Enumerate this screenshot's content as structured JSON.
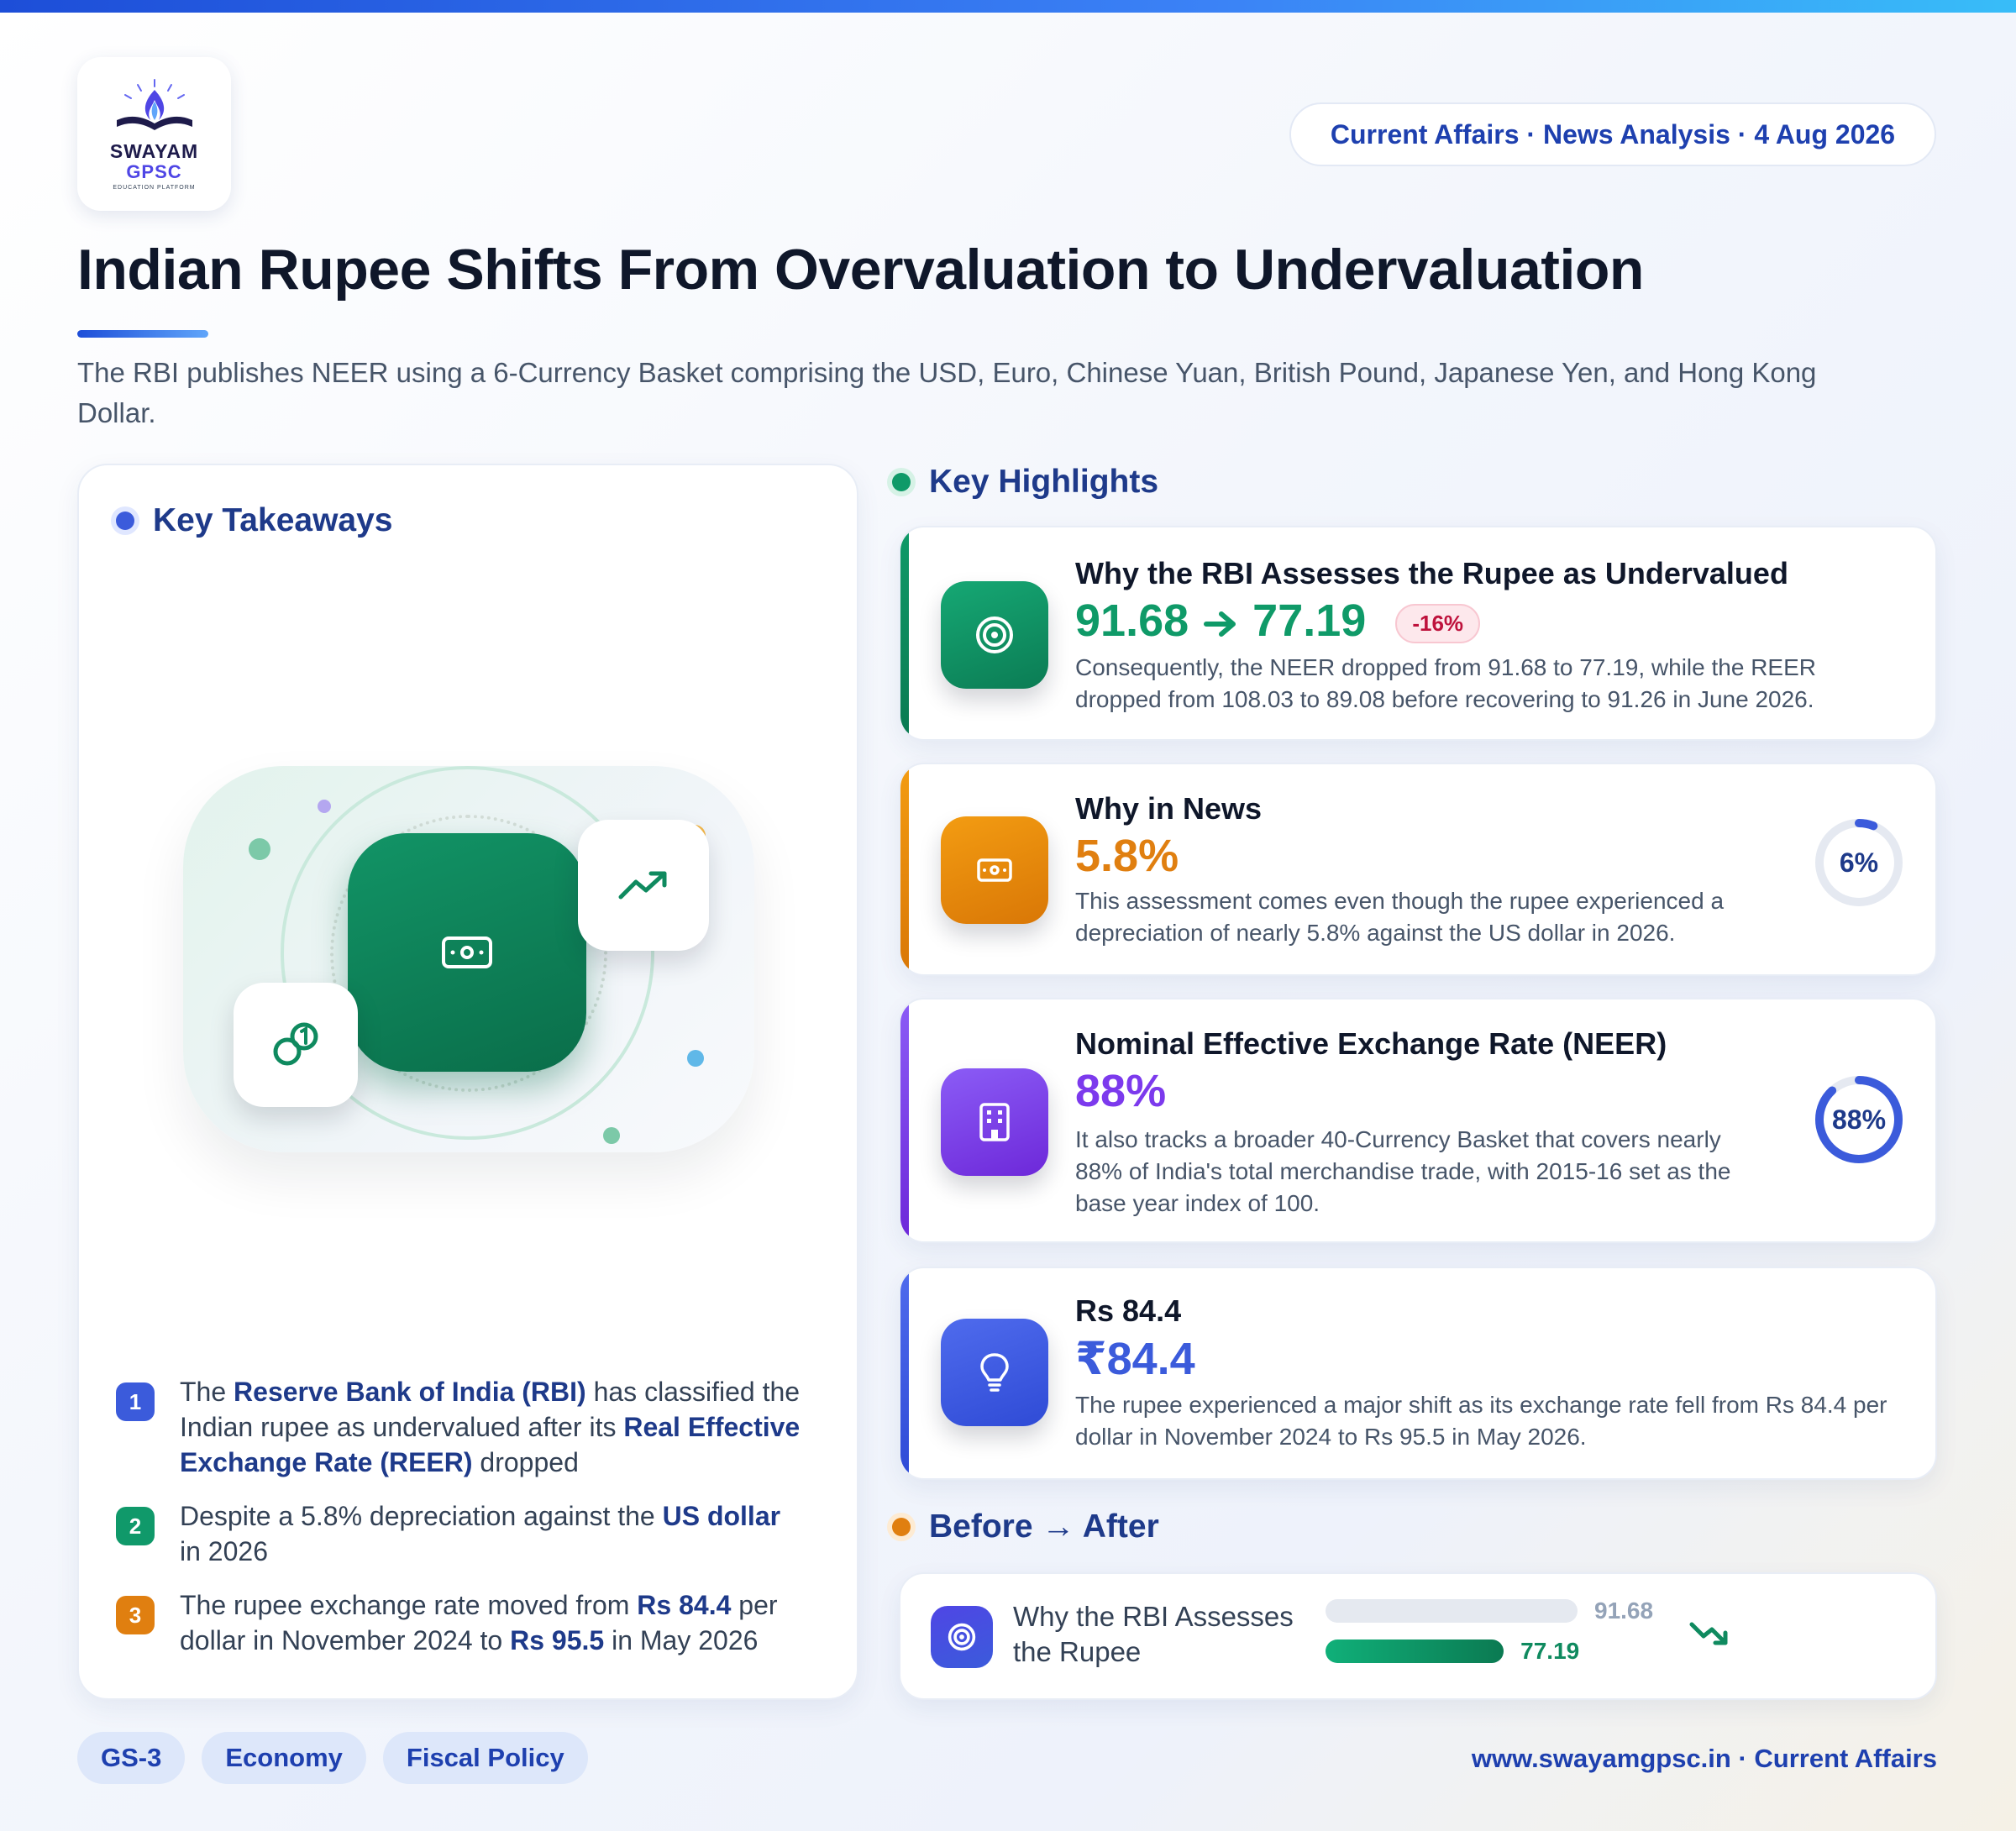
{
  "logo": {
    "line1": "SWAYAM",
    "line2": "GPSC",
    "line3": "EDUCATION PLATFORM"
  },
  "header": {
    "date_pill": "Current Affairs · News Analysis · 4 Aug 2026",
    "title": "Indian Rupee Shifts From Overvaluation to Undervaluation",
    "subtitle": "The RBI publishes NEER using a 6-Currency Basket comprising the USD, Euro, Chinese Yuan, British Pound, Japanese Yen, and Hong Kong Dollar."
  },
  "takeaways": {
    "heading": "Key Takeaways",
    "items": [
      {
        "num": "1",
        "color": "#3b5bdb"
      },
      {
        "num": "2",
        "color": "#10996a"
      },
      {
        "num": "3",
        "color": "#e07f10"
      }
    ],
    "item1": {
      "a": "The ",
      "b": "Reserve Bank of India (RBI)",
      "c": " has classified the Indian rupee as undervalued after its ",
      "d": "Real Effective Exchange Rate (REER)",
      "e": " dropped"
    },
    "item2": {
      "a": "Despite a 5.8% depreciation against the ",
      "b": "US dollar",
      "c": " in 2026"
    },
    "item3": {
      "a": "The rupee exchange rate moved from ",
      "b": "Rs 84.4",
      "c": " per dollar in November 2024 to ",
      "d": "Rs 95.5",
      "e": " in May 2026"
    }
  },
  "highlights": {
    "heading": "Key Highlights",
    "cards": [
      {
        "title": "Why the RBI Assesses the Rupee as Undervalued",
        "from": "91.68",
        "to": "77.19",
        "change": "-16%",
        "desc": "Consequently, the NEER dropped from 91.68 to 77.19, while the REER dropped from 108.03 to 89.08 before recovering to 91.26 in June 2026.",
        "icon": "target-icon",
        "color": "#0f9a68"
      },
      {
        "title": "Why in News",
        "value": "5.8%",
        "gauge_label": "6%",
        "gauge_fraction": 0.06,
        "desc": "This assessment comes even though the rupee experienced a depreciation of nearly 5.8% against the US dollar in 2026.",
        "icon": "banknote-icon",
        "color": "#e07f10"
      },
      {
        "title": "Nominal Effective Exchange Rate (NEER)",
        "value": "88%",
        "gauge_label": "88%",
        "gauge_fraction": 0.88,
        "desc": "It also tracks a broader 40-Currency Basket that covers nearly 88% of India's total merchandise trade, with 2015-16 set as the base year index of 100.",
        "icon": "building-icon",
        "color": "#7c3aed"
      },
      {
        "title": "Rs 84.4",
        "value": "₹84.4",
        "desc": "The rupee experienced a major shift as its exchange rate fell from Rs 84.4 per dollar in November 2024 to Rs 95.5 in May 2026.",
        "icon": "lightbulb-icon",
        "color": "#3b5bdb"
      }
    ]
  },
  "before_after": {
    "heading": "Before → After",
    "label": "Why the RBI Assesses the Rupee",
    "before": 91.68,
    "after": 77.19,
    "before_label": "91.68",
    "after_label": "77.19"
  },
  "tags": [
    "GS-3",
    "Economy",
    "Fiscal Policy"
  ],
  "footer": "www.swayamgpsc.in · Current Affairs"
}
